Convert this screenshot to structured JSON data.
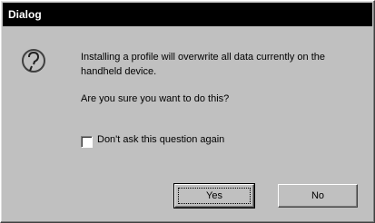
{
  "window": {
    "title": "Dialog"
  },
  "message": {
    "icon": "question-icon",
    "line1": "Installing a profile will overwrite all data currently on the handheld device.",
    "line2": "Are you sure you want to do this?"
  },
  "checkbox": {
    "label": "Don't ask this question again",
    "checked": false
  },
  "buttons": {
    "yes_label": "Yes",
    "no_label": "No"
  }
}
